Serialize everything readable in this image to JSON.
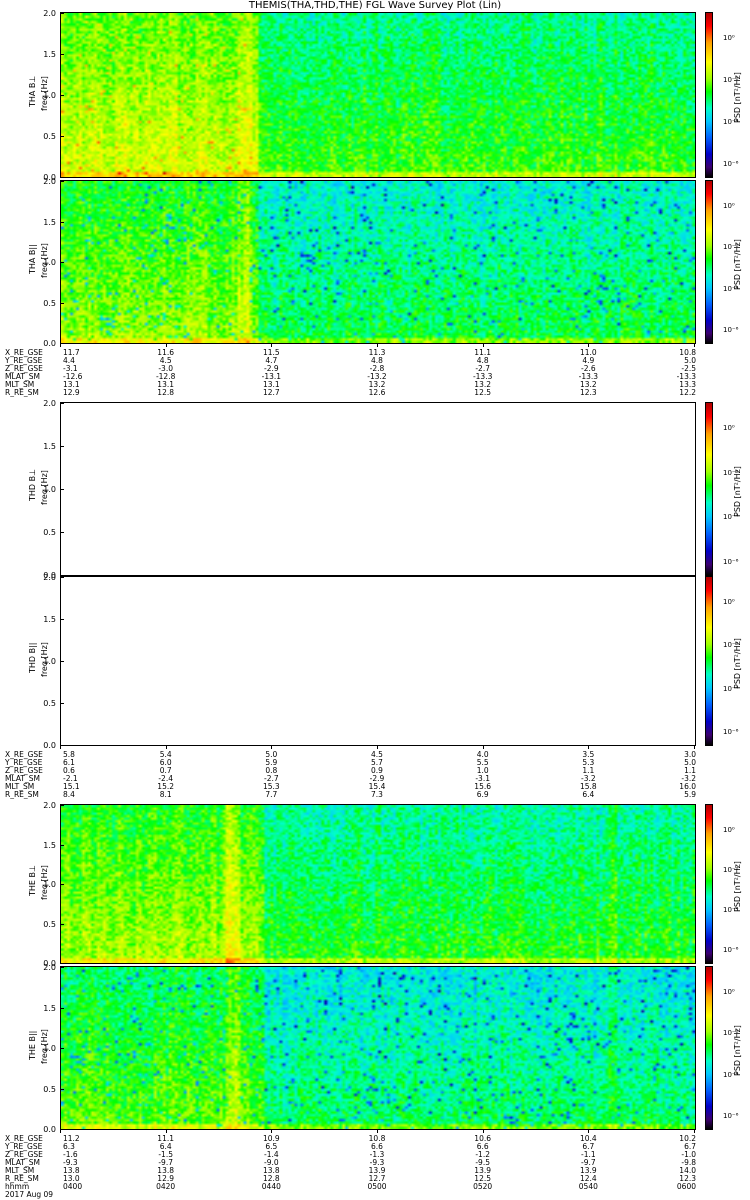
{
  "title": "THEMIS(THA,THD,THE) FGL Wave Survey Plot (Lin)",
  "panels": [
    {
      "id": "tha-bl",
      "label": "THA B⊥",
      "unit": "freq [Hz]",
      "type": "spectrogram",
      "probe": "tha",
      "style": "perp"
    },
    {
      "id": "tha-bpar",
      "label": "THA B||",
      "unit": "freq [Hz]",
      "type": "spectrogram",
      "probe": "tha",
      "style": "par"
    },
    {
      "id": "thd-bl",
      "label": "THD B⊥",
      "unit": "freq [Hz]",
      "type": "empty"
    },
    {
      "id": "thd-bpar",
      "label": "THD B||",
      "unit": "freq [Hz]",
      "type": "empty"
    },
    {
      "id": "the-bl",
      "label": "THE B⊥",
      "unit": "freq [Hz]",
      "type": "spectrogram",
      "probe": "the",
      "style": "perp"
    },
    {
      "id": "the-bpar",
      "label": "THE B||",
      "unit": "freq [Hz]",
      "type": "spectrogram",
      "probe": "the",
      "style": "par"
    }
  ],
  "y_ticks": [
    "0.0",
    "0.5",
    "1.0",
    "1.5",
    "2.0"
  ],
  "colorbar": {
    "label": "PSD [nT²/Hz]",
    "ticks": [
      "10⁰",
      "10⁻²",
      "10⁻⁴",
      "10⁻⁶"
    ]
  },
  "orbit_rows": {
    "tha": {
      "names": [
        "X_RE_GSE",
        "Y_RE_GSE",
        "Z_RE_GSE",
        "MLAT_SM",
        "MLT_SM",
        "R_RE_SM"
      ],
      "columns": [
        [
          "11.7",
          "4.4",
          "-3.1",
          "-12.6",
          "13.1",
          "12.9"
        ],
        [
          "11.6",
          "4.5",
          "-3.0",
          "-12.8",
          "13.1",
          "12.8"
        ],
        [
          "11.5",
          "4.7",
          "-2.9",
          "-13.1",
          "13.1",
          "12.7"
        ],
        [
          "11.3",
          "4.8",
          "-2.8",
          "-13.2",
          "13.2",
          "12.6"
        ],
        [
          "11.1",
          "4.8",
          "-2.7",
          "-13.3",
          "13.2",
          "12.5"
        ],
        [
          "11.0",
          "4.9",
          "-2.6",
          "-13.3",
          "13.2",
          "12.3"
        ],
        [
          "10.8",
          "5.0",
          "-2.5",
          "-13.3",
          "13.3",
          "12.2"
        ]
      ]
    },
    "thd": {
      "names": [
        "X_RE_GSE",
        "Y_RE_GSE",
        "Z_RE_GSE",
        "MLAT_SM",
        "MLT_SM",
        "R_RE_SM"
      ],
      "columns": [
        [
          "5.8",
          "6.1",
          "0.6",
          "-2.1",
          "15.1",
          "8.4"
        ],
        [
          "5.4",
          "6.0",
          "0.7",
          "-2.4",
          "15.2",
          "8.1"
        ],
        [
          "5.0",
          "5.9",
          "0.8",
          "-2.7",
          "15.3",
          "7.7"
        ],
        [
          "4.5",
          "5.7",
          "0.9",
          "-2.9",
          "15.4",
          "7.3"
        ],
        [
          "4.0",
          "5.5",
          "1.0",
          "-3.1",
          "15.6",
          "6.9"
        ],
        [
          "3.5",
          "5.3",
          "1.1",
          "-3.2",
          "15.8",
          "6.4"
        ],
        [
          "3.0",
          "5.0",
          "1.1",
          "-3.2",
          "16.0",
          "5.9"
        ]
      ]
    },
    "the": {
      "names": [
        "X_RE_GSE",
        "Y_RE_GSE",
        "Z_RE_GSE",
        "MLAT_SM",
        "MLT_SM",
        "R_RE_SM",
        "hhmm",
        "2017 Aug 09"
      ],
      "columns": [
        [
          "11.2",
          "6.3",
          "-1.6",
          "-9.3",
          "13.8",
          "13.0",
          "0400"
        ],
        [
          "11.1",
          "6.4",
          "-1.5",
          "-9.7",
          "13.8",
          "12.9",
          "0420"
        ],
        [
          "10.9",
          "6.5",
          "-1.4",
          "-9.0",
          "13.8",
          "12.8",
          "0440"
        ],
        [
          "10.8",
          "6.6",
          "-1.3",
          "-9.3",
          "13.9",
          "12.7",
          "0500"
        ],
        [
          "10.6",
          "6.6",
          "-1.2",
          "-9.5",
          "13.9",
          "12.5",
          "0520"
        ],
        [
          "10.4",
          "6.7",
          "-1.1",
          "-9.7",
          "13.9",
          "12.4",
          "0540"
        ],
        [
          "10.2",
          "6.7",
          "-1.0",
          "-9.8",
          "14.0",
          "12.3",
          "0600"
        ]
      ]
    }
  },
  "chart_data": {
    "type": "heatmap",
    "title": "THEMIS(THA,THD,THE) FGL Wave Survey Plot (Lin)",
    "xlabel": "hhmm",
    "x_ticks": [
      "0400",
      "0420",
      "0440",
      "0500",
      "0520",
      "0540",
      "0600"
    ],
    "date": "2017 Aug 09",
    "ylabel": "freq [Hz]",
    "ylim": [
      0,
      2.0
    ],
    "zlabel": "PSD [nT²/Hz]",
    "zscale": "log",
    "series": [
      {
        "name": "THA B⊥"
      },
      {
        "name": "THA B||"
      },
      {
        "name": "THD B⊥"
      },
      {
        "name": "THD B||"
      },
      {
        "name": "THE B⊥"
      },
      {
        "name": "THE B||"
      }
    ]
  }
}
